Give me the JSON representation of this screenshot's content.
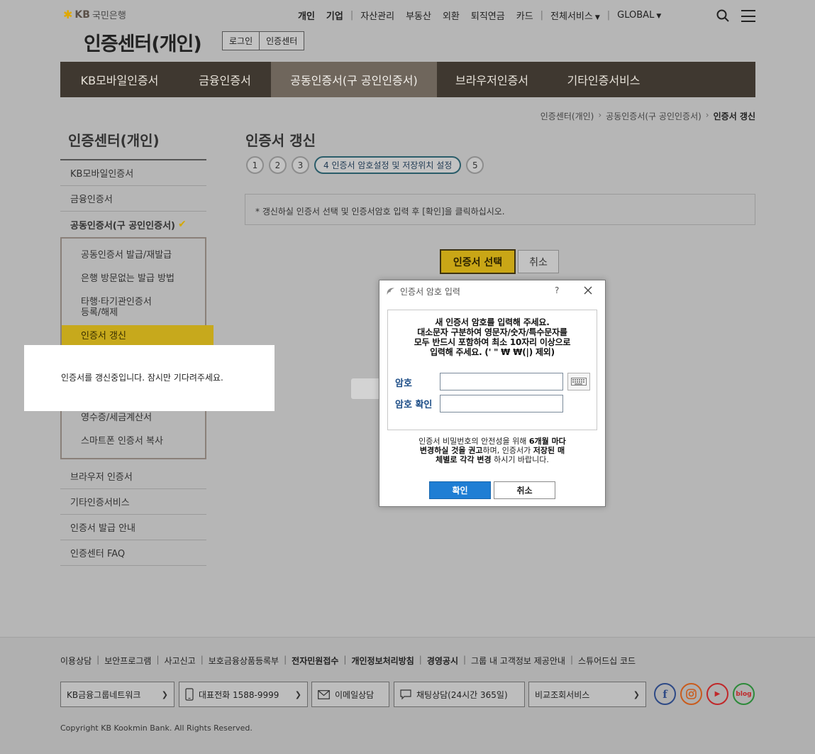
{
  "header": {
    "logo_text": "국민은행",
    "logo_brand": "KB",
    "site_title": "인증센터(개인)",
    "title_tabs": [
      "로그인",
      "인증센터"
    ],
    "top_nav": {
      "personal": "개인",
      "corporate": "기업",
      "asset": "자산관리",
      "realestate": "부동산",
      "fx": "외환",
      "pension": "퇴직연금",
      "card": "카드",
      "all_services": "전체서비스",
      "global": "GLOBAL"
    }
  },
  "main_nav": {
    "tabs": [
      "KB모바일인증서",
      "금융인증서",
      "공동인증서(구 공인인증서)",
      "브라우저인증서",
      "기타인증서비스"
    ],
    "active_index": 2
  },
  "breadcrumb": [
    "인증센터(개인)",
    "공동인증서(구 공인인증서)",
    "인증서 갱신"
  ],
  "sidebar": {
    "title": "인증센터(개인)",
    "items": [
      "KB모바일인증서",
      "금융인증서",
      "공동인증서(구 공인인증서)",
      "브라우저 인증서",
      "기타인증서비스",
      "인증서 발급 안내",
      "인증센터 FAQ"
    ],
    "submenu": [
      "공동인증서 발급/재발급",
      "은행 방문없는 발급 방법",
      "타행·타기관인증서",
      "등록/해제",
      "인증서 갱신",
      "영수증/세금계산서",
      "스마트폰 인증서 복사"
    ]
  },
  "content": {
    "title": "인증서 갱신",
    "steps": [
      "1",
      "2",
      "3",
      "4 인증서 암호설정 및 저장위치 설정",
      "5"
    ],
    "notice": "* 갱신하실 인증서 선택 및 인증서암호 입력 후 [확인]을 클릭하십시오.",
    "select_button": "인증서 선택",
    "cancel_button": "취소"
  },
  "loading_message": "인증서를 갱신중입니다. 잠시만 기다려주세요.",
  "dialog": {
    "title": "인증서 암호 입력",
    "help": "?",
    "message_lines": [
      "새 인증서 암호를 입력해 주세요.",
      "대소문자 구분하여 영문자/숫자/특수문자를",
      "모두 반드시 포함하여 최소 10자리 이상으로",
      "입력해 주세요. (' \" ₩ ₩(|) 제외)"
    ],
    "password_label": "암호",
    "password_confirm_label": "암호 확인",
    "password_value": "",
    "password_confirm_value": "",
    "note": {
      "p1": "인증서 비밀번호의 안전성을 위해 ",
      "b1": "6개월 마다",
      "b2": "변경하실 것을 권고",
      "p2": "하며, 인증서가 ",
      "b3": "저장된 매",
      "b4": "체별로 각각 변경",
      "p3": " 하시기 바랍니다."
    },
    "ok_button": "확인",
    "cancel_button": "취소"
  },
  "footer": {
    "links": [
      {
        "label": "이용상담",
        "bold": false
      },
      {
        "label": "보안프로그램",
        "bold": false
      },
      {
        "label": "사고신고",
        "bold": false
      },
      {
        "label": "보호금융상품등록부",
        "bold": false
      },
      {
        "label": "전자민원접수",
        "bold": true
      },
      {
        "label": "개인정보처리방침",
        "bold": true
      },
      {
        "label": "경영공시",
        "bold": true
      },
      {
        "label": "그룹 내 고객정보 제공안내",
        "bold": false
      },
      {
        "label": "스튜어드십 코드",
        "bold": false
      }
    ],
    "group_network": "KB금융그룹네트워크",
    "phone": "대표전화 1588-9999",
    "email": "이메일상담",
    "chat": "채팅상담(24시간 365일)",
    "compare": "비교조회서비스",
    "social": {
      "facebook": "f",
      "instagram": "instagram",
      "youtube": "▶",
      "blog": "blog"
    },
    "copyright": "Copyright KB Kookmin Bank. All Rights Reserved."
  },
  "colors": {
    "nav_bg": "#3f3830",
    "accent_gold": "#c9a616",
    "dialog_ok": "#1f7ed4",
    "label_blue": "#1b4c86"
  }
}
